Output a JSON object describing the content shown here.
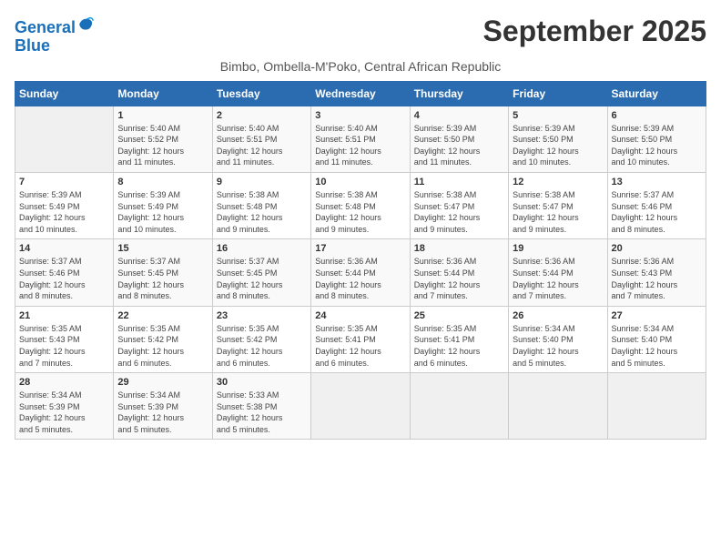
{
  "logo": {
    "line1": "General",
    "line2": "Blue"
  },
  "title": "September 2025",
  "subtitle": "Bimbo, Ombella-M'Poko, Central African Republic",
  "days_header": [
    "Sunday",
    "Monday",
    "Tuesday",
    "Wednesday",
    "Thursday",
    "Friday",
    "Saturday"
  ],
  "weeks": [
    [
      {
        "num": "",
        "detail": ""
      },
      {
        "num": "1",
        "detail": "Sunrise: 5:40 AM\nSunset: 5:52 PM\nDaylight: 12 hours\nand 11 minutes."
      },
      {
        "num": "2",
        "detail": "Sunrise: 5:40 AM\nSunset: 5:51 PM\nDaylight: 12 hours\nand 11 minutes."
      },
      {
        "num": "3",
        "detail": "Sunrise: 5:40 AM\nSunset: 5:51 PM\nDaylight: 12 hours\nand 11 minutes."
      },
      {
        "num": "4",
        "detail": "Sunrise: 5:39 AM\nSunset: 5:50 PM\nDaylight: 12 hours\nand 11 minutes."
      },
      {
        "num": "5",
        "detail": "Sunrise: 5:39 AM\nSunset: 5:50 PM\nDaylight: 12 hours\nand 10 minutes."
      },
      {
        "num": "6",
        "detail": "Sunrise: 5:39 AM\nSunset: 5:50 PM\nDaylight: 12 hours\nand 10 minutes."
      }
    ],
    [
      {
        "num": "7",
        "detail": "Sunrise: 5:39 AM\nSunset: 5:49 PM\nDaylight: 12 hours\nand 10 minutes."
      },
      {
        "num": "8",
        "detail": "Sunrise: 5:39 AM\nSunset: 5:49 PM\nDaylight: 12 hours\nand 10 minutes."
      },
      {
        "num": "9",
        "detail": "Sunrise: 5:38 AM\nSunset: 5:48 PM\nDaylight: 12 hours\nand 9 minutes."
      },
      {
        "num": "10",
        "detail": "Sunrise: 5:38 AM\nSunset: 5:48 PM\nDaylight: 12 hours\nand 9 minutes."
      },
      {
        "num": "11",
        "detail": "Sunrise: 5:38 AM\nSunset: 5:47 PM\nDaylight: 12 hours\nand 9 minutes."
      },
      {
        "num": "12",
        "detail": "Sunrise: 5:38 AM\nSunset: 5:47 PM\nDaylight: 12 hours\nand 9 minutes."
      },
      {
        "num": "13",
        "detail": "Sunrise: 5:37 AM\nSunset: 5:46 PM\nDaylight: 12 hours\nand 8 minutes."
      }
    ],
    [
      {
        "num": "14",
        "detail": "Sunrise: 5:37 AM\nSunset: 5:46 PM\nDaylight: 12 hours\nand 8 minutes."
      },
      {
        "num": "15",
        "detail": "Sunrise: 5:37 AM\nSunset: 5:45 PM\nDaylight: 12 hours\nand 8 minutes."
      },
      {
        "num": "16",
        "detail": "Sunrise: 5:37 AM\nSunset: 5:45 PM\nDaylight: 12 hours\nand 8 minutes."
      },
      {
        "num": "17",
        "detail": "Sunrise: 5:36 AM\nSunset: 5:44 PM\nDaylight: 12 hours\nand 8 minutes."
      },
      {
        "num": "18",
        "detail": "Sunrise: 5:36 AM\nSunset: 5:44 PM\nDaylight: 12 hours\nand 7 minutes."
      },
      {
        "num": "19",
        "detail": "Sunrise: 5:36 AM\nSunset: 5:44 PM\nDaylight: 12 hours\nand 7 minutes."
      },
      {
        "num": "20",
        "detail": "Sunrise: 5:36 AM\nSunset: 5:43 PM\nDaylight: 12 hours\nand 7 minutes."
      }
    ],
    [
      {
        "num": "21",
        "detail": "Sunrise: 5:35 AM\nSunset: 5:43 PM\nDaylight: 12 hours\nand 7 minutes."
      },
      {
        "num": "22",
        "detail": "Sunrise: 5:35 AM\nSunset: 5:42 PM\nDaylight: 12 hours\nand 6 minutes."
      },
      {
        "num": "23",
        "detail": "Sunrise: 5:35 AM\nSunset: 5:42 PM\nDaylight: 12 hours\nand 6 minutes."
      },
      {
        "num": "24",
        "detail": "Sunrise: 5:35 AM\nSunset: 5:41 PM\nDaylight: 12 hours\nand 6 minutes."
      },
      {
        "num": "25",
        "detail": "Sunrise: 5:35 AM\nSunset: 5:41 PM\nDaylight: 12 hours\nand 6 minutes."
      },
      {
        "num": "26",
        "detail": "Sunrise: 5:34 AM\nSunset: 5:40 PM\nDaylight: 12 hours\nand 5 minutes."
      },
      {
        "num": "27",
        "detail": "Sunrise: 5:34 AM\nSunset: 5:40 PM\nDaylight: 12 hours\nand 5 minutes."
      }
    ],
    [
      {
        "num": "28",
        "detail": "Sunrise: 5:34 AM\nSunset: 5:39 PM\nDaylight: 12 hours\nand 5 minutes."
      },
      {
        "num": "29",
        "detail": "Sunrise: 5:34 AM\nSunset: 5:39 PM\nDaylight: 12 hours\nand 5 minutes."
      },
      {
        "num": "30",
        "detail": "Sunrise: 5:33 AM\nSunset: 5:38 PM\nDaylight: 12 hours\nand 5 minutes."
      },
      {
        "num": "",
        "detail": ""
      },
      {
        "num": "",
        "detail": ""
      },
      {
        "num": "",
        "detail": ""
      },
      {
        "num": "",
        "detail": ""
      }
    ]
  ]
}
